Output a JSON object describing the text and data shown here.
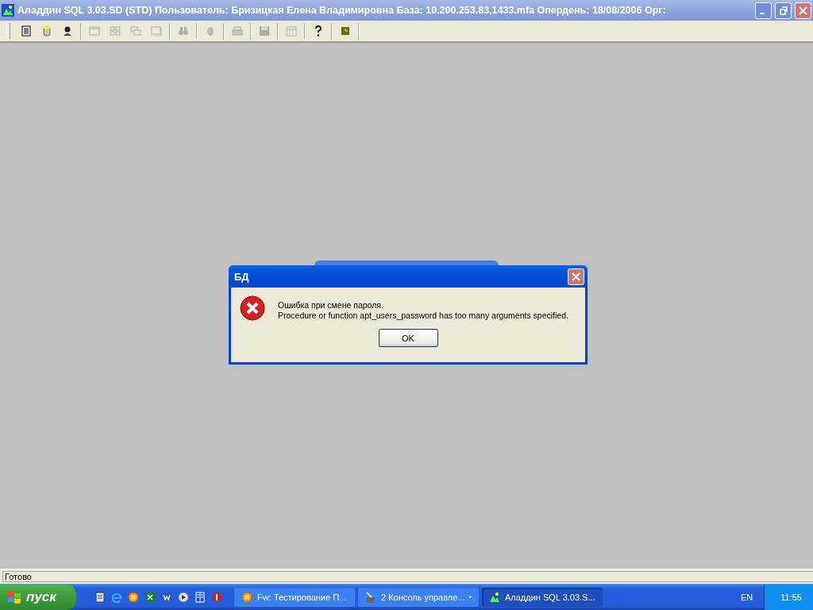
{
  "window": {
    "title": "Аладдин SQL 3.03.SD (STD)  Пользователь: Бризицкая Елена Владимировна База: 10.200.253.83,1433.mfa Опердень: 18/08/2006 Орг:"
  },
  "toolbar": [
    {
      "disabled": false
    },
    {
      "disabled": false
    },
    {
      "disabled": false
    },
    {
      "disabled": true
    },
    {
      "disabled": true
    },
    {
      "disabled": true
    },
    {
      "disabled": true
    },
    {
      "disabled": true
    },
    {
      "disabled": true
    },
    {
      "disabled": true
    },
    {
      "disabled": true
    },
    {
      "disabled": true
    },
    {
      "disabled": false
    },
    {
      "disabled": false
    }
  ],
  "dialog": {
    "title": "БД",
    "message_lines": [
      "Ошибка при смене пароля.",
      "Procedure or function apt_users_password has too many arguments specified."
    ],
    "button": "OK"
  },
  "status_bar": "Готово",
  "taskbar": {
    "start": "пуск",
    "tasks": [
      {
        "label": "Fw: Тестирование П...",
        "selected": false,
        "kind": "single"
      },
      {
        "label": "2 Консоль управле...",
        "selected": false,
        "kind": "group"
      },
      {
        "label": "Аладдин SQL 3.03.S...",
        "selected": true,
        "kind": "single"
      }
    ],
    "language": "EN",
    "clock": "11:55"
  }
}
